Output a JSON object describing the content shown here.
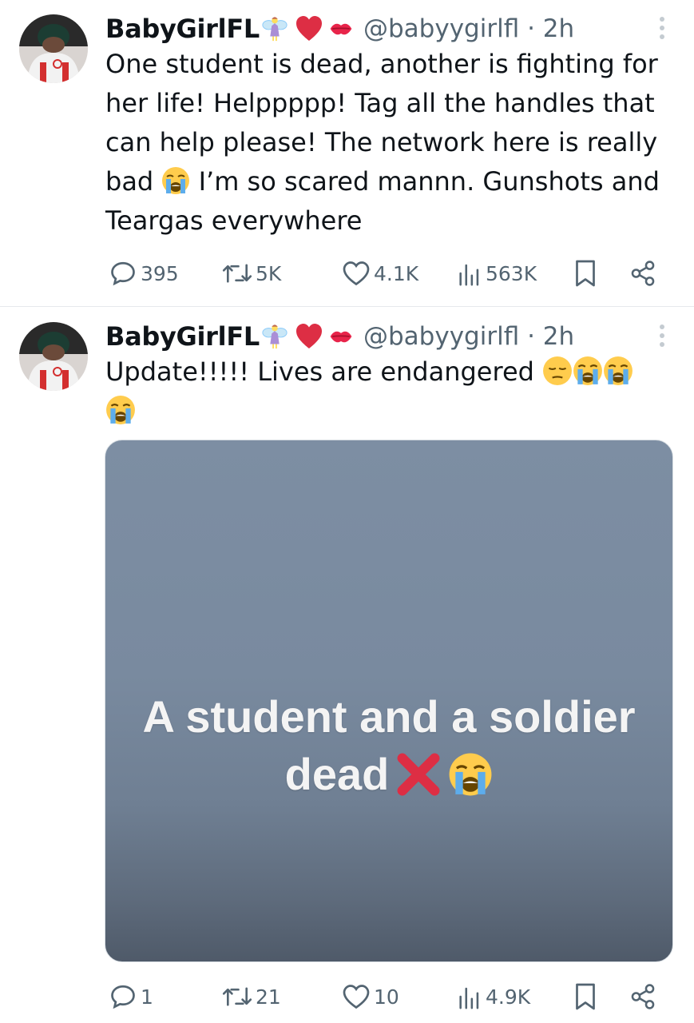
{
  "tweets": [
    {
      "display_name": "BabyGirlFL",
      "name_emojis": [
        "fairy-emoji",
        "red-heart-emoji",
        "kiss-mark-emoji"
      ],
      "handle_time": "@babyygirlfl · 2h",
      "text_parts": {
        "before_emoji": "One student is dead, another is fighting for her life! Helppppp! Tag all the handles that can help please! The network here is really bad ",
        "after_emoji": " I’m so scared mannn. Gunshots and Teargas everywhere"
      },
      "stats": {
        "replies": "395",
        "retweets": "5K",
        "likes": "4.1K",
        "views": "563K"
      }
    },
    {
      "display_name": "BabyGirlFL",
      "name_emojis": [
        "fairy-emoji",
        "red-heart-emoji",
        "kiss-mark-emoji"
      ],
      "handle_time": "@babyygirlfl · 2h",
      "text": "Update!!!!! Lives are endangered ",
      "trailing_emojis": [
        "pensive-face-emoji",
        "loudly-crying-face-emoji",
        "loudly-crying-face-emoji",
        "loudly-crying-face-emoji"
      ],
      "media": {
        "caption_line1": "A student and a soldier",
        "caption_line2": "dead",
        "caption_emojis": [
          "cross-mark-emoji",
          "loudly-crying-face-emoji"
        ]
      },
      "stats": {
        "replies": "1",
        "retweets": "21",
        "likes": "10",
        "views": "4.9K"
      }
    }
  ],
  "colors": {
    "text": "#0f1419",
    "secondary": "#536471",
    "divider": "#e6e9ec",
    "media_bg": "#7d8ea3"
  }
}
